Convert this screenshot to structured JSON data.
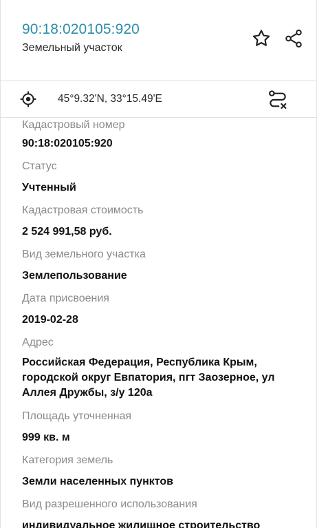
{
  "header": {
    "cadastral_number": "90:18:020105:920",
    "object_type": "Земельный участок"
  },
  "icons": {
    "favorite": "star-icon",
    "share": "share-icon",
    "locate": "crosshair-icon",
    "route": "route-icon"
  },
  "coordinates": {
    "text": "45°9.32'N, 33°15.49'E"
  },
  "fields": [
    {
      "label": "Кадастровый номер",
      "value": "90:18:020105:920"
    },
    {
      "label": "Статус",
      "value": "Учтенный"
    },
    {
      "label": "Кадастровая стоимость",
      "value": "2 524 991,58 руб."
    },
    {
      "label": "Вид земельного участка",
      "value": "Землепользование"
    },
    {
      "label": "Дата присвоения",
      "value": "2019-02-28"
    },
    {
      "label": "Адрес",
      "value": "Российская Федерация, Республика Крым, городской округ Евпатория, пгт Заозерное, ул Аллея Дружбы, з/у 120а"
    },
    {
      "label": "Площадь уточненная",
      "value": "999 кв. м"
    },
    {
      "label": "Категория земель",
      "value": "Земли населенных пунктов"
    },
    {
      "label": "Вид разрешенного использования",
      "value": "индивидуальное жилищное строительство"
    }
  ],
  "colors": {
    "accent": "#2d8ea8",
    "label": "#8a8a8a",
    "value": "#111111"
  }
}
